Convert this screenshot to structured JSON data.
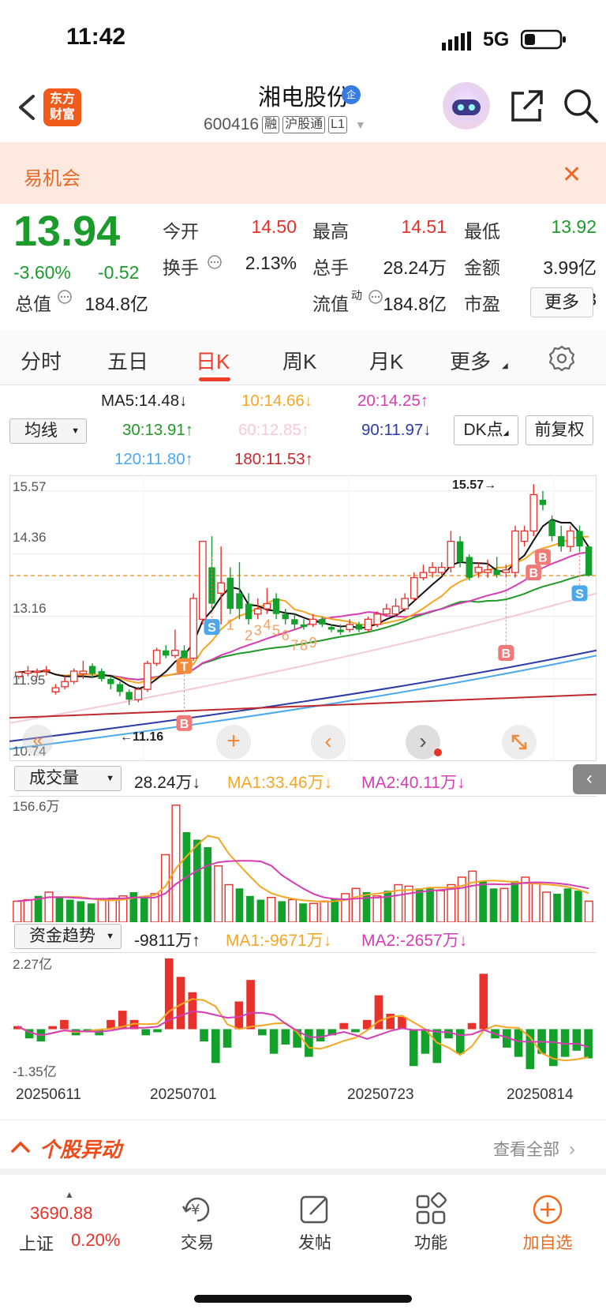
{
  "status": {
    "time": "11:42",
    "network": "5G"
  },
  "header": {
    "logo_text_1": "东方",
    "logo_text_2": "财富",
    "stock_name": "湘电股份",
    "badge": "企",
    "code": "600416",
    "tags": [
      "融",
      "沪股通",
      "L1"
    ]
  },
  "banner": {
    "text": "易机会"
  },
  "quote": {
    "price": "13.94",
    "change_pct": "-3.60%",
    "change": "-0.52",
    "fields": [
      {
        "label": "今开",
        "value": "14.50",
        "color": "#e8312a"
      },
      {
        "label": "最高",
        "value": "14.51",
        "color": "#e8312a"
      },
      {
        "label": "最低",
        "value": "13.92",
        "color": "#1a9b2a"
      },
      {
        "label": "换手",
        "value": "2.13%",
        "color": "#222222"
      },
      {
        "label": "总手",
        "value": "28.24万",
        "color": "#222222"
      },
      {
        "label": "金额",
        "value": "3.99亿",
        "color": "#222222"
      },
      {
        "label": "总值",
        "value": "184.8亿",
        "color": "#222222"
      },
      {
        "label": "流值",
        "value": "184.8亿",
        "color": "#222222"
      },
      {
        "label": "市盈",
        "value": "49.03",
        "color": "#222222"
      }
    ],
    "pe_sup": "动",
    "more": "更多"
  },
  "tabs": [
    "分时",
    "五日",
    "日K",
    "周K",
    "月K",
    "更多"
  ],
  "ma": {
    "select": "均线",
    "items": [
      {
        "text": "MA5:14.48↓",
        "color": "#222222"
      },
      {
        "text": "10:14.66↓",
        "color": "#f5a623"
      },
      {
        "text": "20:14.25↑",
        "color": "#d63cb4"
      },
      {
        "text": "30:13.91↑",
        "color": "#1f9a27"
      },
      {
        "text": "60:12.85↑",
        "color": "#f6c9d8"
      },
      {
        "text": "90:11.97↓",
        "color": "#2b3aa8"
      },
      {
        "text": "120:11.80↑",
        "color": "#4aa8ef"
      },
      {
        "text": "180:11.53↑",
        "color": "#c0282c"
      }
    ],
    "dk": "DK点",
    "fq": "前复权"
  },
  "kline": {
    "y_labels": [
      "15.57",
      "14.36",
      "13.16",
      "11.95",
      "10.74"
    ],
    "high_label": "15.57→",
    "low_label": "←11.16",
    "current_price": 13.94,
    "wave_labels": [
      "1",
      "2",
      "3",
      "4",
      "5",
      "6",
      "7",
      "8",
      "9"
    ],
    "signal_b": "B",
    "signal_s": "S",
    "signal_t": "T",
    "candles": [
      [
        12.0,
        12.08,
        11.95,
        12.1
      ],
      [
        12.06,
        12.1,
        12.0,
        12.2
      ],
      [
        12.08,
        12.1,
        11.98,
        12.15
      ],
      [
        12.1,
        12.12,
        12.02,
        12.2
      ],
      [
        11.7,
        11.78,
        11.65,
        11.85
      ],
      [
        11.8,
        11.9,
        11.75,
        12.0
      ],
      [
        11.9,
        12.1,
        11.85,
        12.15
      ],
      [
        12.05,
        12.1,
        11.95,
        12.3
      ],
      [
        12.2,
        12.05,
        11.98,
        12.25
      ],
      [
        12.1,
        11.95,
        11.9,
        12.15
      ],
      [
        11.95,
        11.85,
        11.75,
        12.0
      ],
      [
        11.85,
        11.7,
        11.62,
        11.9
      ],
      [
        11.7,
        11.55,
        11.45,
        11.75
      ],
      [
        11.55,
        11.75,
        11.5,
        11.8
      ],
      [
        11.75,
        12.25,
        11.7,
        12.3
      ],
      [
        12.25,
        12.5,
        12.2,
        12.55
      ],
      [
        12.5,
        12.4,
        12.35,
        12.6
      ],
      [
        12.4,
        12.5,
        12.35,
        12.9
      ],
      [
        12.5,
        12.35,
        12.3,
        12.6
      ],
      [
        12.35,
        13.5,
        12.3,
        13.6
      ],
      [
        13.1,
        14.6,
        13.0,
        14.4
      ],
      [
        14.1,
        13.4,
        13.3,
        14.7
      ],
      [
        13.6,
        13.8,
        13.0,
        14.5
      ],
      [
        13.9,
        13.3,
        13.2,
        14.1
      ],
      [
        13.6,
        13.3,
        13.1,
        14.2
      ],
      [
        13.4,
        13.1,
        13.0,
        13.6
      ],
      [
        13.2,
        13.3,
        13.1,
        13.5
      ],
      [
        13.3,
        13.4,
        13.2,
        13.7
      ],
      [
        13.5,
        13.2,
        13.1,
        13.6
      ],
      [
        13.2,
        13.1,
        13.0,
        13.3
      ],
      [
        13.1,
        13.0,
        12.9,
        13.2
      ],
      [
        13.0,
        12.95,
        12.9,
        13.1
      ],
      [
        13.0,
        13.1,
        12.95,
        13.2
      ],
      [
        13.1,
        13.0,
        12.95,
        13.15
      ],
      [
        12.95,
        12.9,
        12.85,
        13.0
      ],
      [
        12.9,
        12.85,
        12.8,
        13.0
      ],
      [
        12.9,
        13.0,
        12.85,
        13.1
      ],
      [
        13.0,
        12.9,
        12.85,
        13.05
      ],
      [
        12.9,
        13.1,
        12.85,
        13.15
      ],
      [
        13.0,
        13.2,
        12.95,
        13.25
      ],
      [
        13.2,
        13.3,
        13.15,
        13.4
      ],
      [
        13.2,
        13.35,
        13.15,
        13.5
      ],
      [
        13.3,
        13.5,
        13.25,
        13.6
      ],
      [
        13.5,
        13.9,
        13.45,
        14.0
      ],
      [
        13.9,
        14.0,
        13.85,
        14.15
      ],
      [
        14.0,
        14.1,
        13.9,
        14.2
      ],
      [
        14.0,
        14.1,
        13.95,
        14.2
      ],
      [
        14.1,
        14.6,
        14.0,
        14.8
      ],
      [
        14.6,
        14.2,
        14.1,
        14.7
      ],
      [
        14.3,
        13.9,
        13.85,
        14.35
      ],
      [
        14.0,
        14.1,
        13.9,
        14.2
      ],
      [
        14.0,
        14.05,
        13.9,
        14.25
      ],
      [
        14.05,
        13.95,
        13.9,
        14.3
      ],
      [
        14.0,
        14.05,
        13.9,
        14.15
      ],
      [
        14.0,
        14.8,
        13.9,
        14.9
      ],
      [
        14.6,
        14.8,
        14.5,
        14.9
      ],
      [
        14.8,
        15.5,
        14.7,
        15.7
      ],
      [
        15.4,
        15.3,
        15.2,
        15.57
      ],
      [
        15.0,
        14.7,
        14.6,
        15.1
      ],
      [
        14.7,
        14.5,
        14.4,
        14.9
      ],
      [
        14.5,
        14.8,
        14.4,
        14.9
      ],
      [
        14.8,
        14.5,
        14.4,
        14.9
      ],
      [
        14.5,
        13.94,
        13.92,
        14.51
      ]
    ]
  },
  "volume": {
    "select": "成交量",
    "value": "28.24万↓",
    "ma1": "MA1:33.46万↓",
    "ma2": "MA2:40.11万↓",
    "max_label": "156.6万",
    "bars": [
      [
        28,
        1
      ],
      [
        30,
        1
      ],
      [
        35,
        0
      ],
      [
        40,
        1
      ],
      [
        34,
        0
      ],
      [
        30,
        0
      ],
      [
        28,
        0
      ],
      [
        25,
        0
      ],
      [
        30,
        1
      ],
      [
        32,
        1
      ],
      [
        35,
        1
      ],
      [
        40,
        0
      ],
      [
        35,
        0
      ],
      [
        38,
        1
      ],
      [
        90,
        1
      ],
      [
        156,
        1
      ],
      [
        120,
        0
      ],
      [
        110,
        0
      ],
      [
        100,
        0
      ],
      [
        75,
        1
      ],
      [
        50,
        1
      ],
      [
        45,
        0
      ],
      [
        35,
        0
      ],
      [
        30,
        0
      ],
      [
        33,
        1
      ],
      [
        28,
        0
      ],
      [
        30,
        1
      ],
      [
        25,
        0
      ],
      [
        25,
        1
      ],
      [
        28,
        1
      ],
      [
        32,
        0
      ],
      [
        38,
        1
      ],
      [
        45,
        1
      ],
      [
        40,
        0
      ],
      [
        35,
        1
      ],
      [
        42,
        0
      ],
      [
        50,
        1
      ],
      [
        48,
        1
      ],
      [
        45,
        0
      ],
      [
        45,
        0
      ],
      [
        42,
        1
      ],
      [
        50,
        1
      ],
      [
        60,
        1
      ],
      [
        68,
        1
      ],
      [
        55,
        0
      ],
      [
        45,
        0
      ],
      [
        45,
        1
      ],
      [
        55,
        0
      ],
      [
        60,
        1
      ],
      [
        52,
        1
      ],
      [
        40,
        1
      ],
      [
        38,
        0
      ],
      [
        45,
        0
      ],
      [
        42,
        0
      ],
      [
        28,
        1
      ]
    ]
  },
  "fund": {
    "select": "资金趋势",
    "value": "-9811万↑",
    "ma1": "MA1:-9671万↓",
    "ma2": "MA2:-2657万↓",
    "max_label": "2.27亿",
    "min_label": "-1.35亿",
    "bars": [
      0.1,
      -0.3,
      -0.4,
      0.1,
      0.3,
      -0.2,
      -0.1,
      -0.2,
      0.3,
      0.6,
      0.3,
      -0.2,
      -0.1,
      2.3,
      1.7,
      1.2,
      -0.4,
      -1.1,
      -0.6,
      0.9,
      1.6,
      -0.2,
      -0.8,
      -0.5,
      -0.6,
      -0.9,
      -0.4,
      -0.2,
      0.2,
      -0.1,
      0.3,
      1.1,
      0.5,
      0.4,
      -1.2,
      -0.8,
      -1.1,
      -0.3,
      -0.8,
      0.2,
      1.8,
      -0.3,
      -0.6,
      -0.9,
      -1.3,
      -0.8,
      -1.2,
      -0.9,
      -0.7,
      -0.95
    ]
  },
  "dates": [
    "20250611",
    "20250701",
    "20250723",
    "20250814"
  ],
  "section": {
    "title": "个股异动",
    "all": "查看全部"
  },
  "bottom_nav": {
    "index_value": "3690.88",
    "index_name": "上证",
    "index_change": "0.20%",
    "items": [
      "交易",
      "发帖",
      "功能",
      "加自选"
    ]
  }
}
